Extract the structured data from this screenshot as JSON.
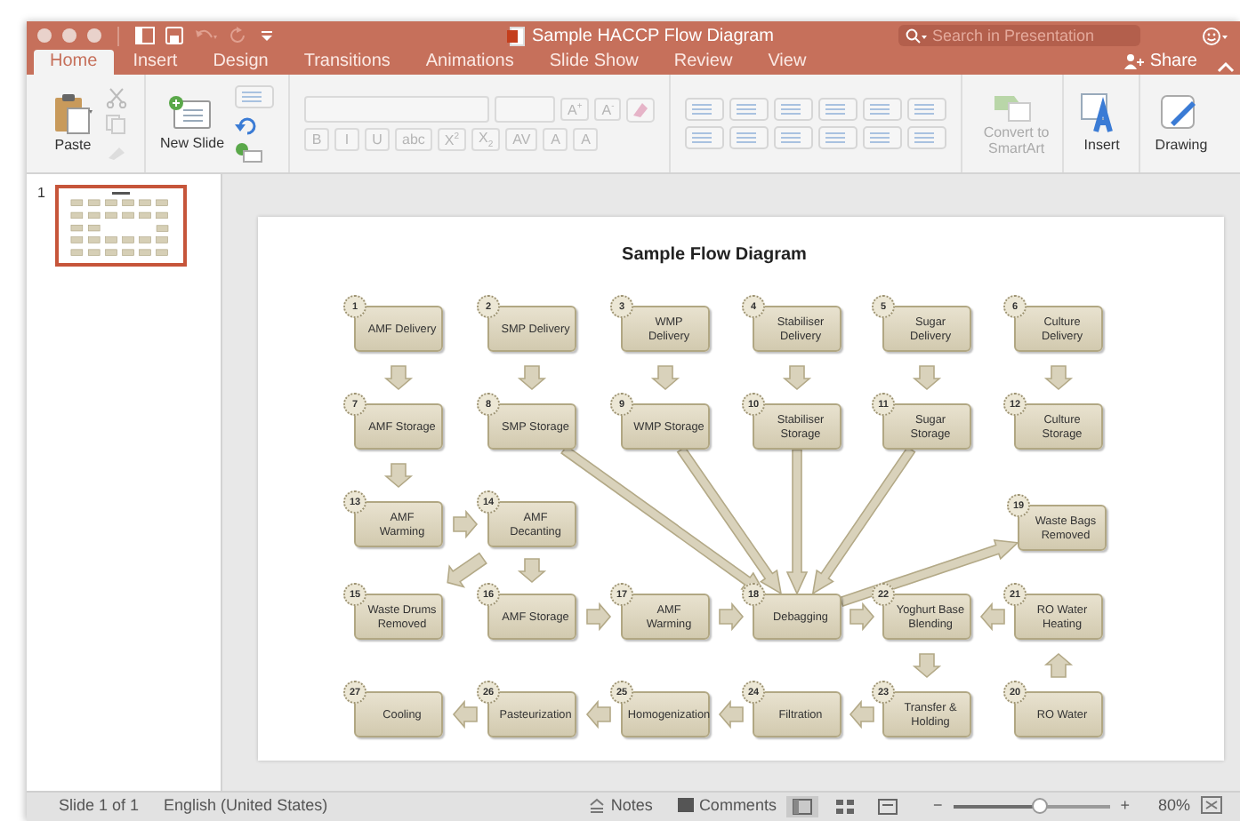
{
  "window": {
    "title": "Sample HACCP Flow Diagram",
    "search": {
      "placeholder": "Search in Presentation"
    }
  },
  "tabs": [
    {
      "label": "Home",
      "selected": true
    },
    {
      "label": "Insert",
      "selected": false
    },
    {
      "label": "Design",
      "selected": false
    },
    {
      "label": "Transitions",
      "selected": false
    },
    {
      "label": "Animations",
      "selected": false
    },
    {
      "label": "Slide Show",
      "selected": false
    },
    {
      "label": "Review",
      "selected": false
    },
    {
      "label": "View",
      "selected": false
    }
  ],
  "share": {
    "label": "Share"
  },
  "ribbon": {
    "paste": "Paste",
    "new_slide": "New Slide",
    "font_top": [
      {
        "label": "A$^{+}$",
        "disabled": true
      },
      {
        "label": "A$^{-}$",
        "disabled": true
      }
    ],
    "font_bottom": [
      {
        "label": "B",
        "disabled": true
      },
      {
        "label": "I",
        "disabled": true
      },
      {
        "label": "U",
        "disabled": true
      },
      {
        "label": "abc",
        "disabled": true
      },
      {
        "label": "X$^{2}$",
        "disabled": true
      },
      {
        "label": "X$_{2}$",
        "disabled": true
      },
      {
        "label": "AV",
        "disabled": true
      },
      {
        "label": "A",
        "disabled": true
      },
      {
        "label": "A",
        "disabled": true
      }
    ],
    "convert": {
      "label": "Convert to SmartArt",
      "disabled": true
    },
    "insert": "Insert",
    "drawing": "Drawing"
  },
  "slides_pane": {
    "number": "1",
    "selected": true
  },
  "slide": {
    "title": "Sample Flow Diagram",
    "nodes": [
      {
        "number": "1",
        "label": "AMF Delivery"
      },
      {
        "number": "2",
        "label": "SMP Delivery"
      },
      {
        "number": "3",
        "label": "WMP Delivery"
      },
      {
        "number": "4",
        "label": "Stabiliser Delivery"
      },
      {
        "number": "5",
        "label": "Sugar Delivery"
      },
      {
        "number": "6",
        "label": "Culture Delivery"
      },
      {
        "number": "7",
        "label": "AMF Storage"
      },
      {
        "number": "8",
        "label": "SMP Storage"
      },
      {
        "number": "9",
        "label": "WMP Storage"
      },
      {
        "number": "10",
        "label": "Stabiliser Storage"
      },
      {
        "number": "11",
        "label": "Sugar Storage"
      },
      {
        "number": "12",
        "label": "Culture Storage"
      },
      {
        "number": "13",
        "label": "AMF Warming"
      },
      {
        "number": "14",
        "label": "AMF Decanting"
      },
      {
        "number": "19",
        "label": "Waste Bags Removed"
      },
      {
        "number": "15",
        "label": "Waste Drums Removed"
      },
      {
        "number": "16",
        "label": "AMF Storage"
      },
      {
        "number": "17",
        "label": "AMF Warming"
      },
      {
        "number": "18",
        "label": "Debagging"
      },
      {
        "number": "22",
        "label": "Yoghurt Base Blending"
      },
      {
        "number": "21",
        "label": "RO Water Heating"
      },
      {
        "number": "27",
        "label": "Cooling"
      },
      {
        "number": "26",
        "label": "Pasteurization"
      },
      {
        "number": "25",
        "label": "Homogenization"
      },
      {
        "number": "24",
        "label": "Filtration"
      },
      {
        "number": "23",
        "label": "Transfer & Holding"
      },
      {
        "number": "20",
        "label": "RO Water"
      }
    ]
  },
  "status_bar": {
    "slide": "Slide 1 of 1",
    "language": "English (United States)",
    "notes": "Notes",
    "comments": "Comments",
    "views": [
      {
        "kind": "normal",
        "selected": true
      },
      {
        "kind": "sorter",
        "selected": false
      },
      {
        "kind": "reading",
        "selected": false
      }
    ],
    "zoom_out": "−",
    "zoom": {
      "level": 0.55
    },
    "zoom_in": "+",
    "zoom_value": "80%"
  }
}
